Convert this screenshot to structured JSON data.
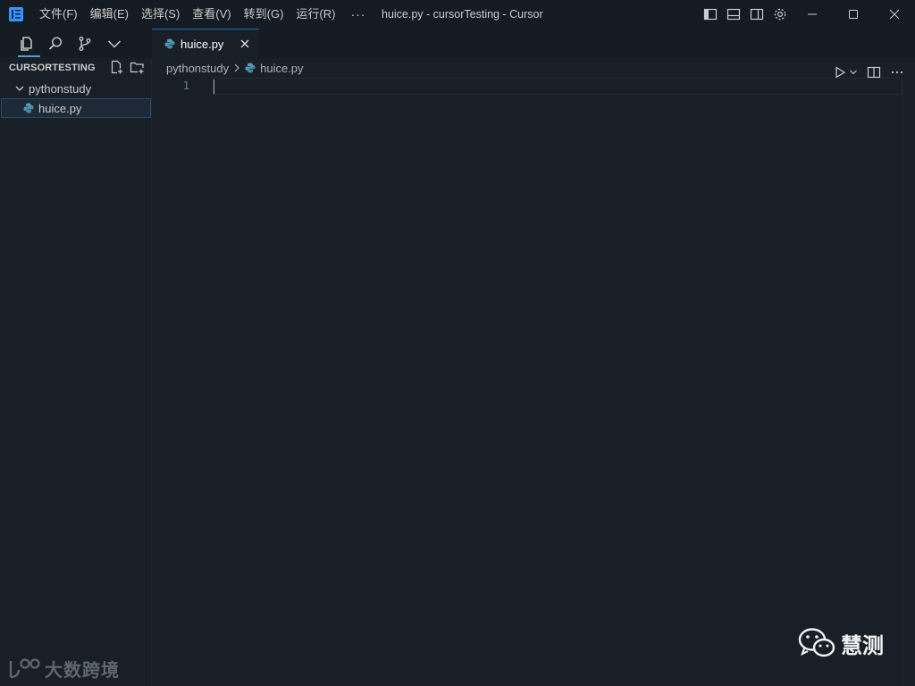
{
  "titlebar": {
    "menu": [
      "文件(F)",
      "编辑(E)",
      "选择(S)",
      "查看(V)",
      "转到(G)",
      "运行(R)"
    ],
    "more": "···",
    "window_title": "huice.py - cursorTesting - Cursor"
  },
  "tabs": [
    {
      "label": "huice.py",
      "active": true
    }
  ],
  "sidebar": {
    "title": "CURSORTESTING",
    "tree": [
      {
        "label": "pythonstudy",
        "type": "folder",
        "expanded": true
      },
      {
        "label": "huice.py",
        "type": "file",
        "selected": true
      }
    ]
  },
  "breadcrumb": {
    "folder": "pythonstudy",
    "file": "huice.py"
  },
  "editor": {
    "line_numbers": [
      "1"
    ]
  },
  "watermarks": {
    "left": "大数跨境",
    "right": "慧测"
  },
  "colors": {
    "background": "#181f27",
    "titlebar": "#141b22",
    "accent": "#4d9dd6",
    "python_icon": "#519aba"
  }
}
